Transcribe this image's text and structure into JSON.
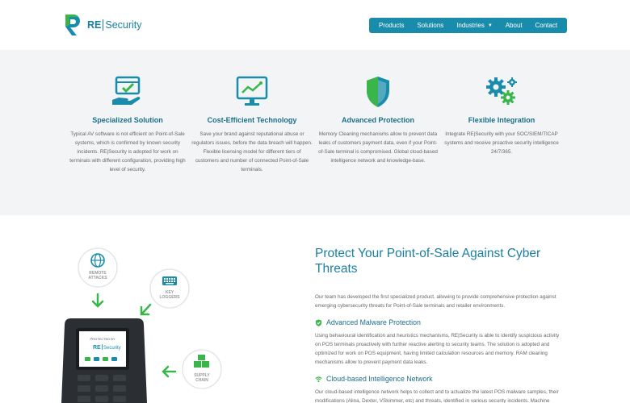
{
  "brand": {
    "name_prefix": "RE",
    "name_suffix": "Security",
    "accent_color": "#1a8cab",
    "heading_color": "#1a6e88",
    "green_color": "#3ab54a"
  },
  "nav": {
    "items": [
      {
        "label": "Products"
      },
      {
        "label": "Solutions"
      },
      {
        "label": "Industries",
        "has_dropdown": true
      },
      {
        "label": "About"
      },
      {
        "label": "Contact"
      }
    ]
  },
  "features": [
    {
      "icon": "hand-shield-check-icon",
      "title": "Specialized Solution",
      "text": "Typical AV software is not efficient on Point-of-Sale systems, which is confirmed by known security incidents. RE|Security is adopted for work on terminals with different configuration, providing high level of security."
    },
    {
      "icon": "monitor-trend-icon",
      "title": "Cost-Efficient Technology",
      "text": "Save your brand against reputational abuse or regulators issues, before the data breach will happen. Flexible licensing model for different tiers of customers and number of connected Point-of-Sale terminals."
    },
    {
      "icon": "shield-icon",
      "title": "Advanced Protection",
      "text": "Memory Cleaning mechanisms allow to prevent data leaks of customers payment data, even if your Point-of-Sale terminal is compromised. Global cloud-based intelligence network and knowledge-base."
    },
    {
      "icon": "gears-icon",
      "title": "Flexible Integration",
      "text": "Integrate RE|Security with your SOC/SIEM/TICAP systems and receive proactive security intelligence 24/7/365."
    }
  ],
  "illustration": {
    "bubbles": [
      {
        "icon": "globe-icon",
        "label_line1": "REMOTE",
        "label_line2": "ATTACKS"
      },
      {
        "icon": "keyboard-icon",
        "label_line1": "KEY",
        "label_line2": "LOGGERS"
      },
      {
        "icon": "boxes-icon",
        "label_line1": "SUPPLY",
        "label_line2": "CHAIN"
      }
    ],
    "screen_text_small": "PROTECTED BY",
    "screen_brand_prefix": "RE",
    "screen_brand_suffix": "Security"
  },
  "main": {
    "title": "Protect Your Point-of-Sale Against Cyber Threats",
    "intro": "Our team has developed the first specialized product, allowing to provide comprehensive protection against emerging cybersecurity threats for Point-of-Sale terminals and retailer environments.",
    "sections": [
      {
        "icon": "shield-check-icon",
        "heading": "Advanced Malware Protection",
        "text": "Using behavioural identification and heuristics mechanisms, RE|Security is able to identify suspicious activity on POS terminals proactively with further reactive alerting to security teams. The solution is adopted and optimized for work on POS equipment, having limited calculation resources and memory. RAM cleaning mechanisms allow to prevent payment data leaks."
      },
      {
        "icon": "wifi-icon",
        "heading": "Cloud-based Intelligence Network",
        "text": "Our cloud-based intelligence network helps to collect and to actualize the latest POS malware samples, their modifications (Alina, Dexter, VSkimmer, etc) and threats, identified in various security incidents. Machine learning engine algorithms allow to improve timely identification of malicious activity."
      }
    ]
  }
}
